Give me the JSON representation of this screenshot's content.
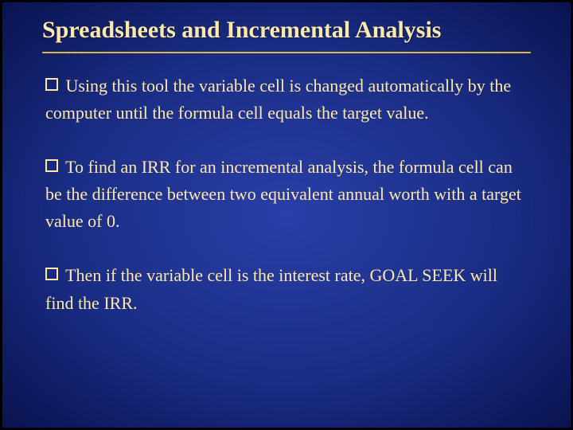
{
  "title": "Spreadsheets and Incremental Analysis",
  "bullets": [
    "Using this tool the variable cell is changed automatically by the computer until the formula cell equals the target value.",
    "To find an IRR for an incremental analysis, the formula cell can be the difference between two equivalent annual worth with a target value of 0.",
    "Then if the variable cell is the interest rate, GOAL SEEK will find the IRR."
  ]
}
